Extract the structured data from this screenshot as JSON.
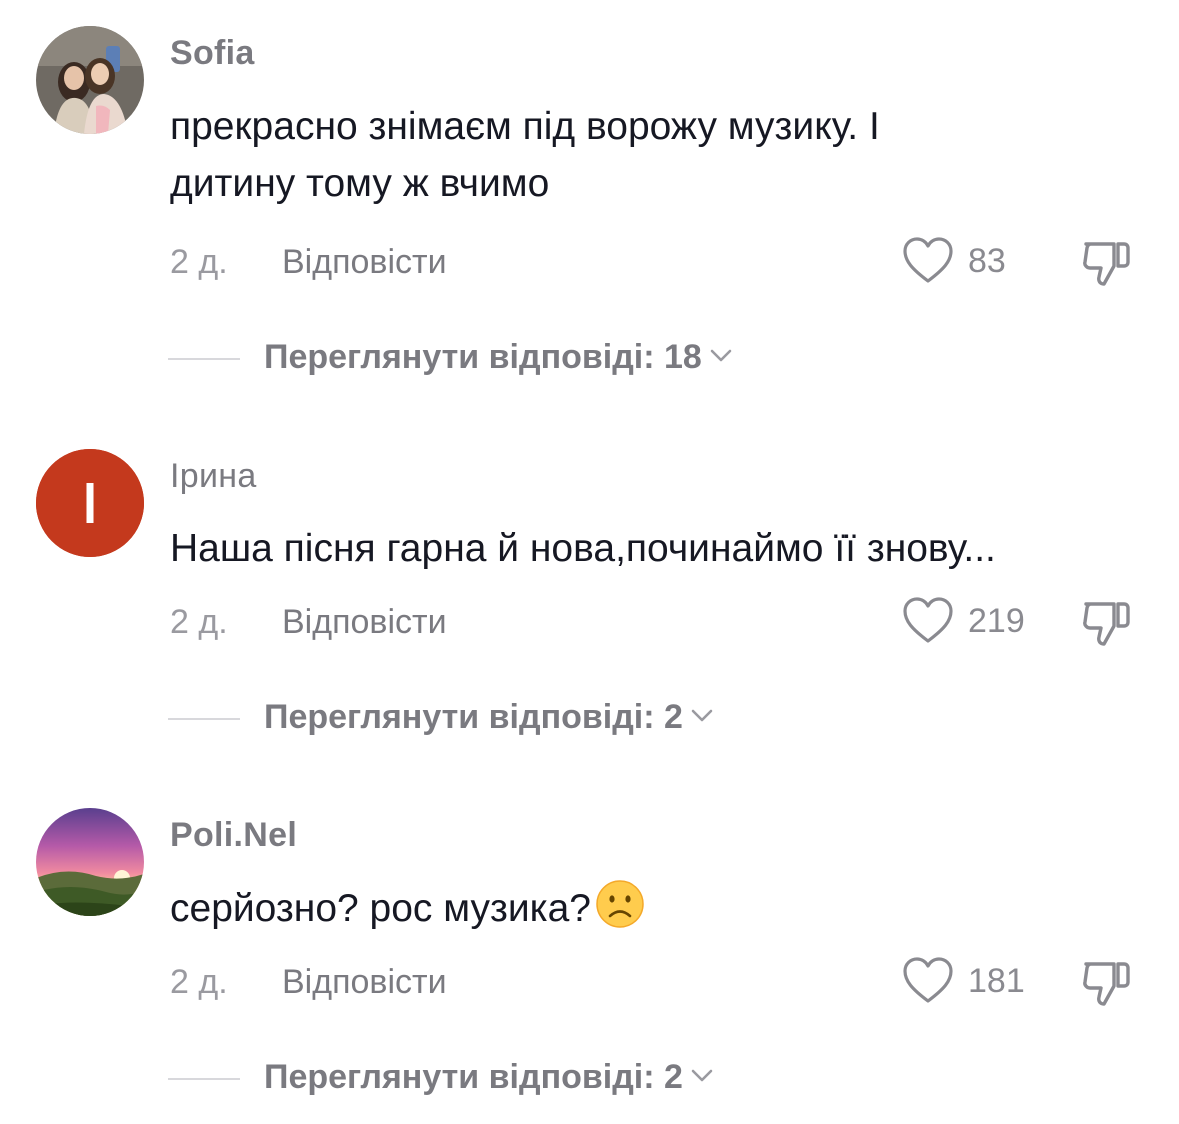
{
  "comments": [
    {
      "username": "Sofia",
      "text_line1": "прекрасно знімаєм під ворожу музику. І",
      "text_line2": "дитину тому ж вчимо",
      "time": "2 д.",
      "reply_label": "Відповісти",
      "likes": "83",
      "view_replies": "Переглянути відповіді: 18"
    },
    {
      "username": "Ірина",
      "avatar_letter": "I",
      "text_line1": "Наша пісня гарна й нова,починаймо її знову...",
      "time": "2 д.",
      "reply_label": "Відповісти",
      "likes": "219",
      "view_replies": "Переглянути відповіді: 2"
    },
    {
      "username": "Poli.Nel",
      "text_line1": "серйозно? рос музика?",
      "time": "2 д.",
      "reply_label": "Відповісти",
      "likes": "181",
      "view_replies": "Переглянути відповіді: 2"
    }
  ],
  "icons": {
    "like": "heart-outline-icon",
    "dislike": "thumbs-down-icon",
    "expand": "chevron-down-icon",
    "emoji": "frowning-face-emoji"
  },
  "colors": {
    "avatar_irina": "#c4391d",
    "text": "#161823",
    "secondary": "#7a7a80"
  }
}
